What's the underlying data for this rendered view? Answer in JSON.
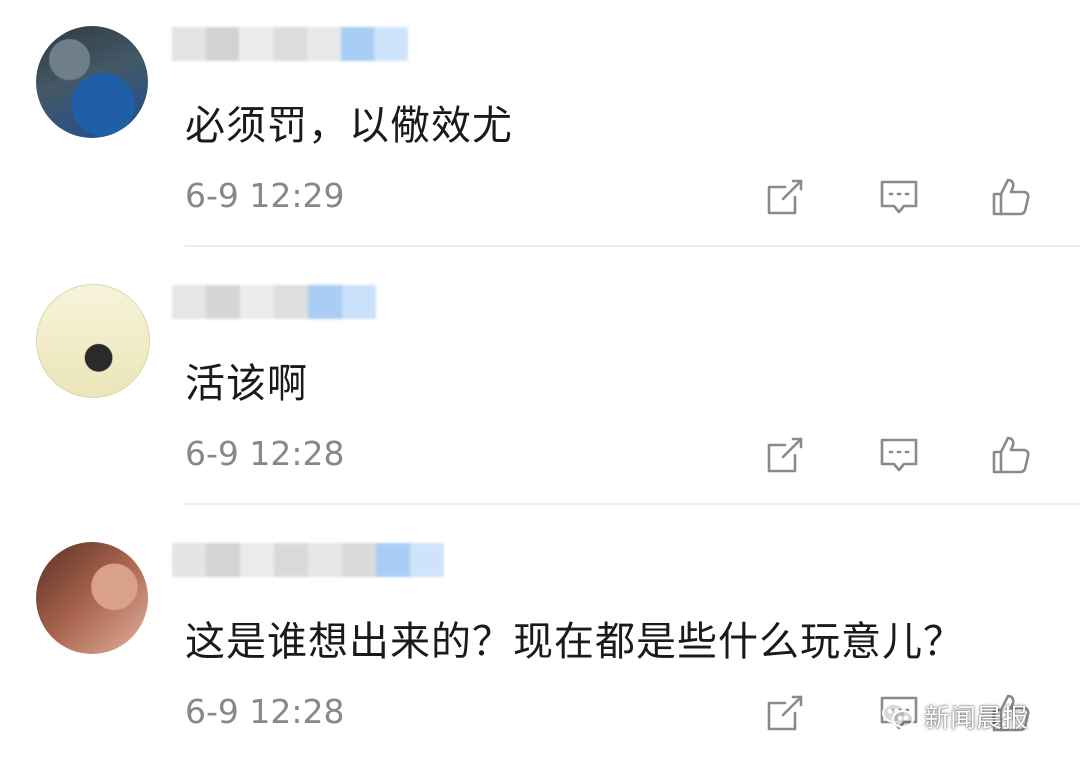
{
  "comments": [
    {
      "text": "必须罚，以儆效尤",
      "time": "6-9 12:29"
    },
    {
      "text": "活该啊",
      "time": "6-9 12:28"
    },
    {
      "text": "这是谁想出来的？现在都是些什么玩意儿？",
      "time": "6-9 12:28"
    }
  ],
  "icons": {
    "share": "share-icon",
    "reply": "comment-icon",
    "like": "thumbs-up-icon",
    "watermark_logo": "wechat-icon"
  },
  "watermark": {
    "label": "新闻晨报"
  },
  "colors": {
    "text": "#1a1a1a",
    "meta": "#888888",
    "icon": "#8a8a8a",
    "divider": "#ececec",
    "name_blur_accent": "#a9cdf5"
  }
}
